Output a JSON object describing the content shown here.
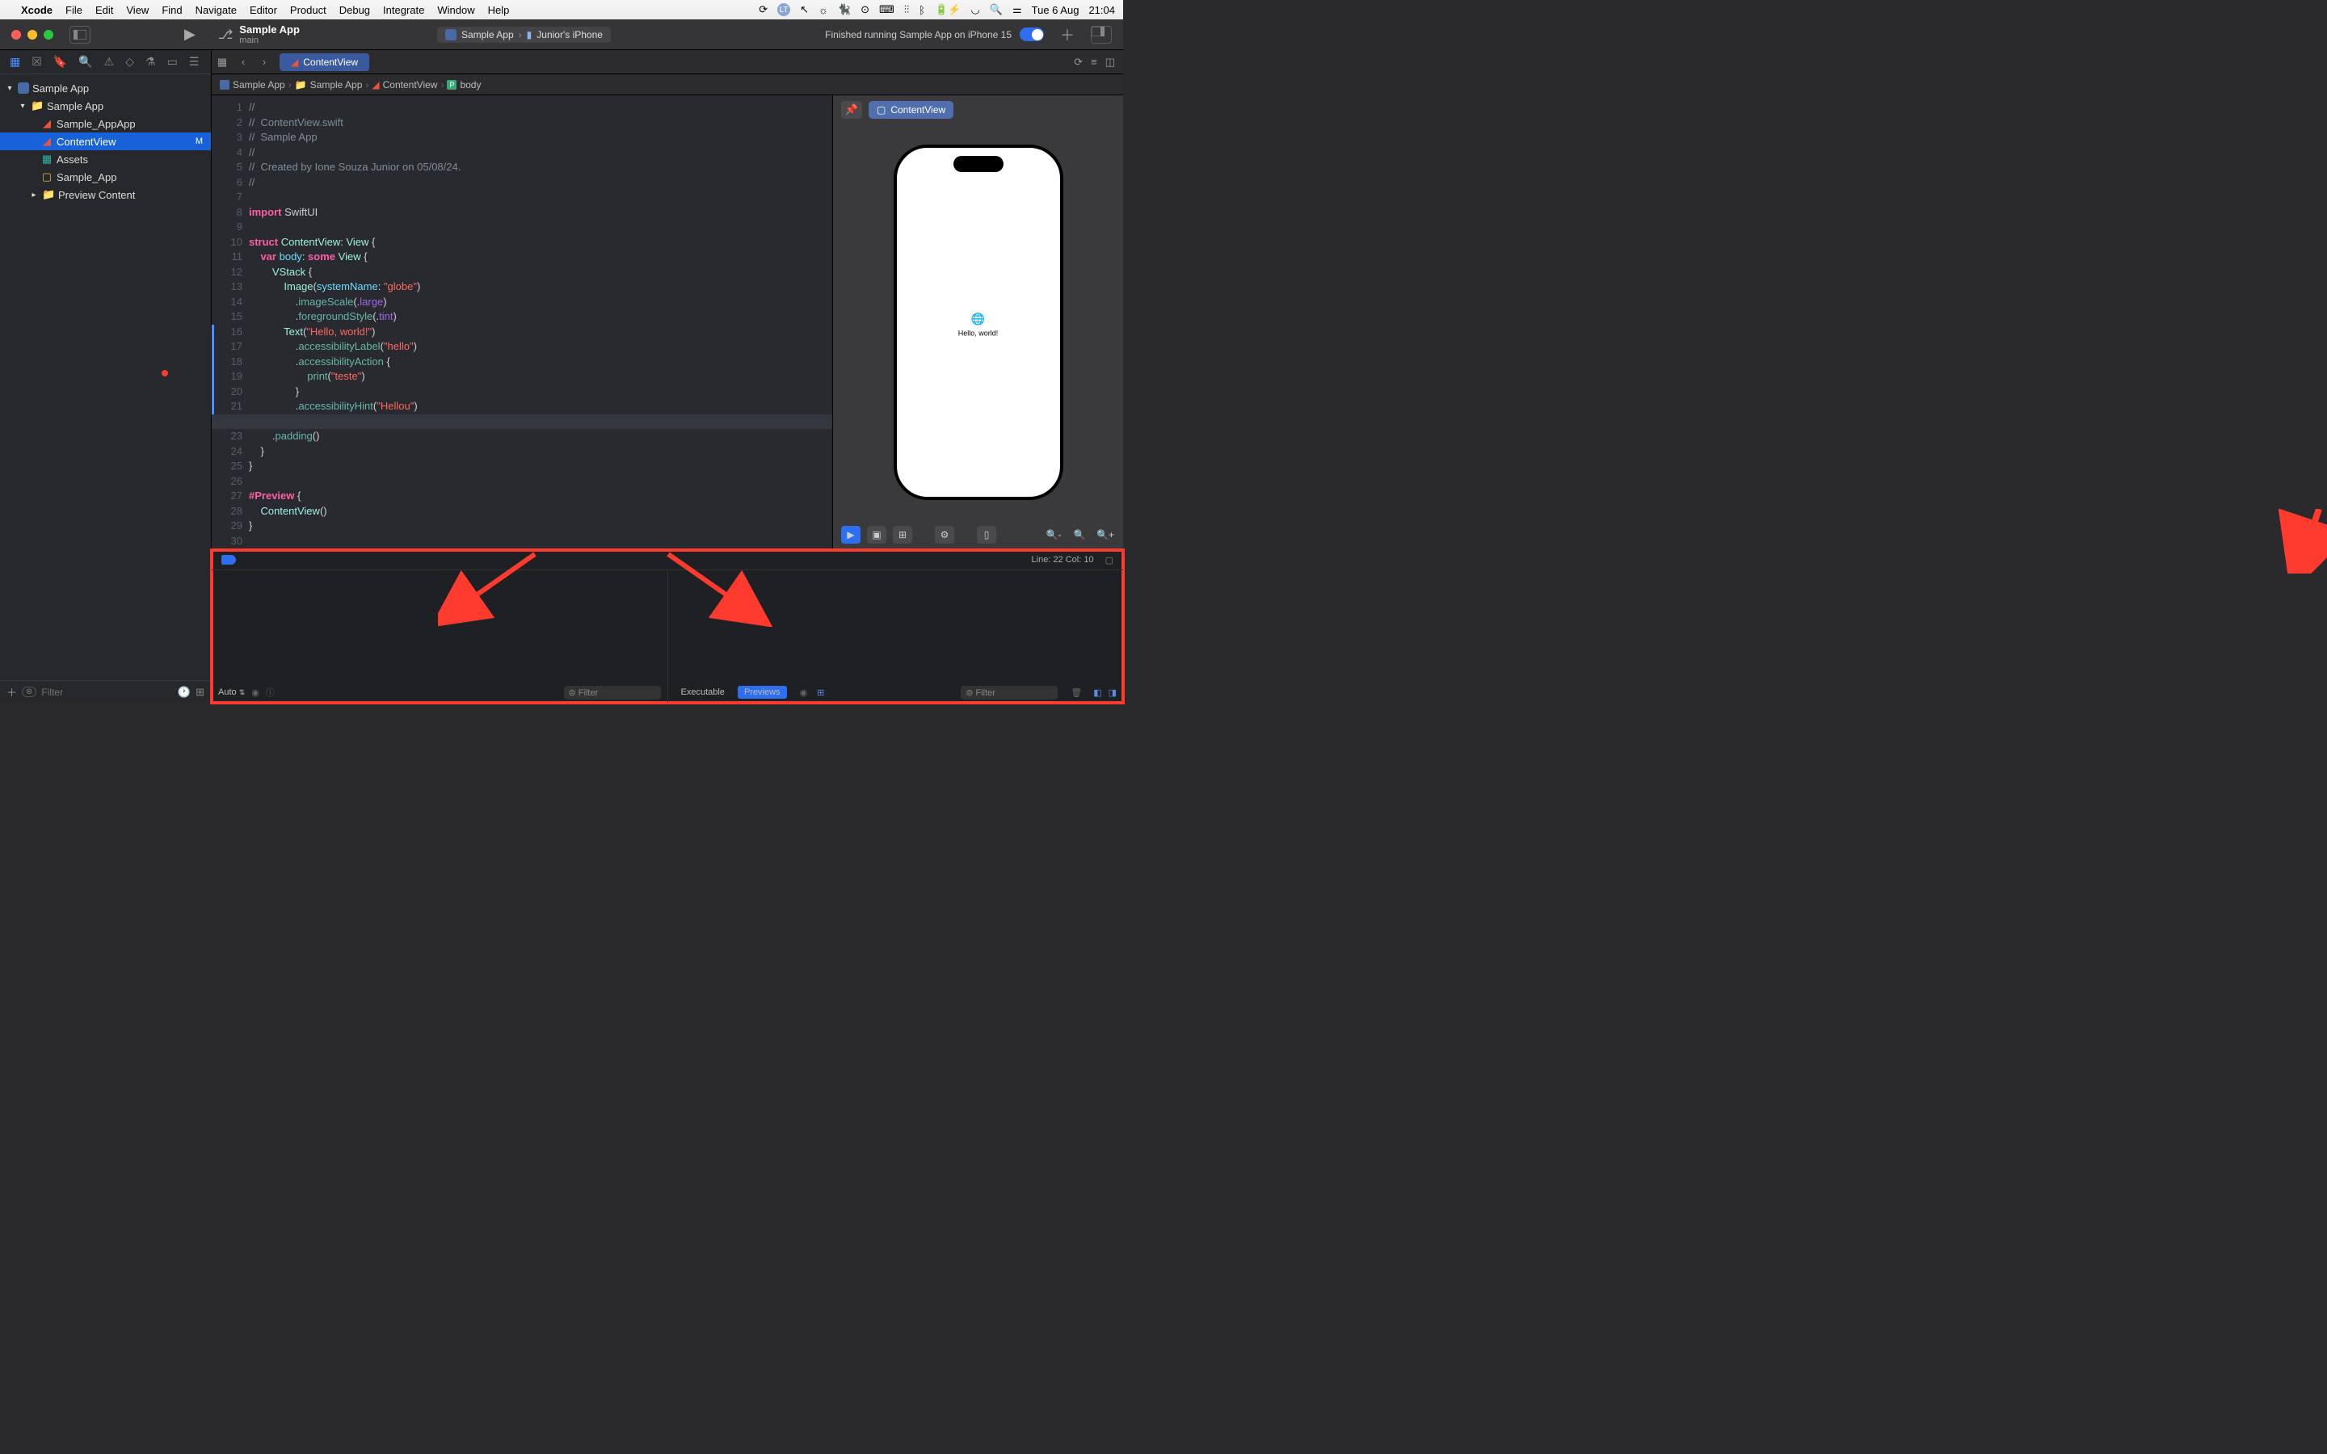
{
  "menubar": {
    "app": "Xcode",
    "items": [
      "File",
      "Edit",
      "View",
      "Find",
      "Navigate",
      "Editor",
      "Product",
      "Debug",
      "Integrate",
      "Window",
      "Help"
    ],
    "date": "Tue 6 Aug",
    "time": "21:04"
  },
  "toolbar": {
    "project": "Sample App",
    "branch": "main",
    "scheme_app": "Sample App",
    "scheme_device": "Junior's iPhone",
    "status": "Finished running Sample App on iPhone 15"
  },
  "tabs": {
    "active": "ContentView"
  },
  "jumpbar": [
    "Sample App",
    "Sample App",
    "ContentView",
    "body"
  ],
  "tree": {
    "root": "Sample App",
    "folder": "Sample App",
    "files": {
      "app": "Sample_AppApp",
      "content": "ContentView",
      "content_badge": "M",
      "assets": "Assets",
      "entitle": "Sample_App",
      "preview": "Preview Content"
    }
  },
  "filter_placeholder": "Filter",
  "code": {
    "l1": "//",
    "l2": "//  ContentView.swift",
    "l3": "//  Sample App",
    "l4": "//",
    "l5": "//  Created by Ione Souza Junior on 05/08/24.",
    "l6": "//",
    "l10": " ContentView",
    "l17_str": "\"hello\"",
    "l19_str": "\"teste\"",
    "l21_str": "\"Hellou\"",
    "l16_str": "\"Hello, world!\"",
    "l13_str": "\"globe\""
  },
  "preview": {
    "pin_label": "ContentView",
    "device_text": "Hello, world!"
  },
  "debug": {
    "line_col": "Line: 22   Col: 10",
    "auto": "Auto",
    "exec": "Executable",
    "prev": "Previews"
  }
}
